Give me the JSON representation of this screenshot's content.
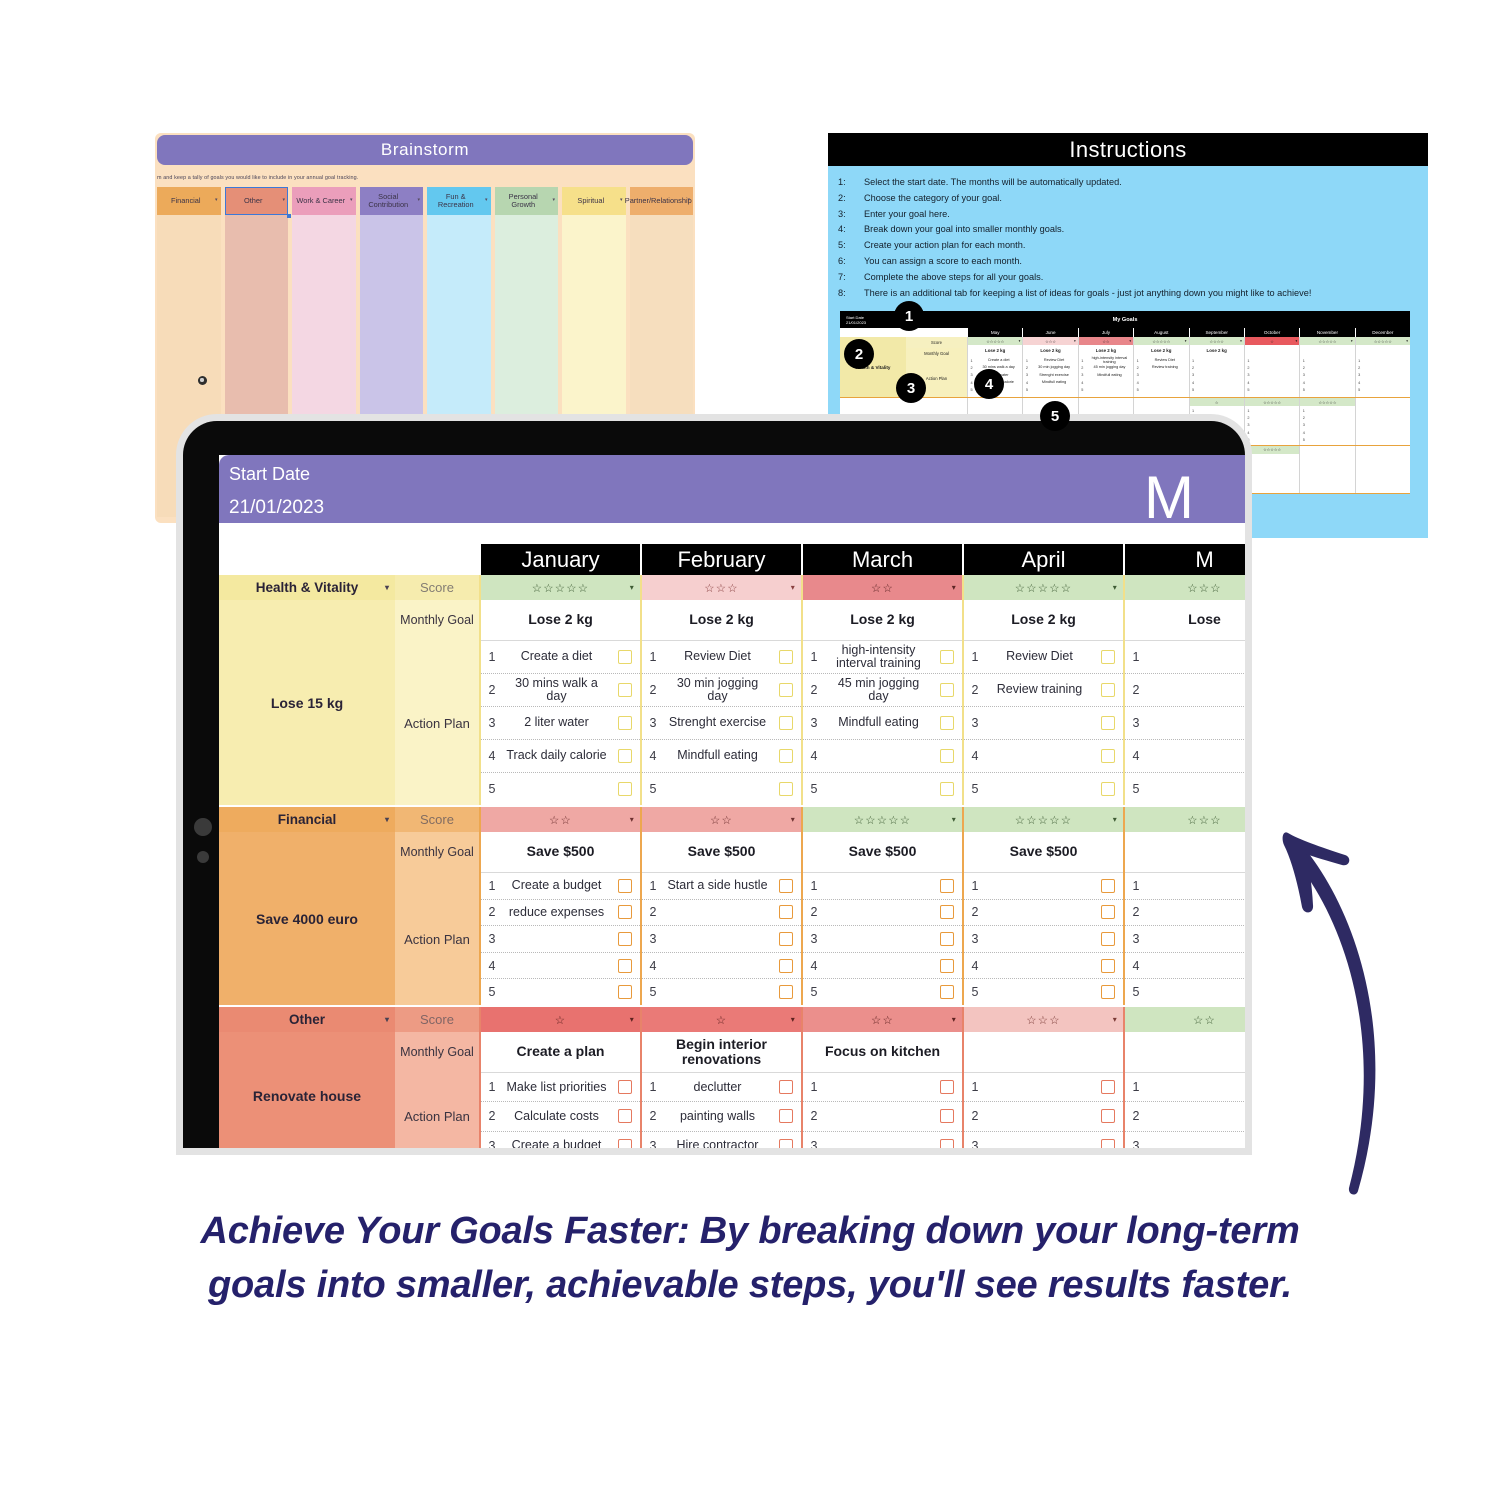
{
  "brainstorm": {
    "title": "Brainstorm",
    "subtitle": "m and keep a tally of goals you would like to include in your annual goal tracking.",
    "columns": [
      {
        "label": "Financial",
        "head_color": "#ecaa5a",
        "body_color": "#f7dcb9",
        "selected": false
      },
      {
        "label": "Other",
        "head_color": "#e58f77",
        "body_color": "#e8bdae",
        "selected": true
      },
      {
        "label": "Work & Career",
        "head_color": "#eb9ebb",
        "body_color": "#f4d7e3",
        "selected": false
      },
      {
        "label": "Social Contribution",
        "head_color": "#8d7fc4",
        "body_color": "#cac4e8",
        "selected": false
      },
      {
        "label": "Fun & Recreation",
        "head_color": "#63c8ef",
        "body_color": "#c5ebfa",
        "selected": false
      },
      {
        "label": "Personal Growth",
        "head_color": "#b7d6b0",
        "body_color": "#dceede",
        "selected": false
      },
      {
        "label": "Spiritual",
        "head_color": "#f6e08a",
        "body_color": "#fbf4cb",
        "selected": false
      },
      {
        "label": "Partner/Relationship",
        "head_color": "#eeae6c",
        "body_color": "#f6debe",
        "selected": false
      }
    ],
    "caret": "▾"
  },
  "instructions": {
    "title": "Instructions",
    "background": "#8ed8f8",
    "items": [
      {
        "num": "1:",
        "text": "Select the start date. The months will be automatically updated."
      },
      {
        "num": "2:",
        "text": "Choose the category of your goal."
      },
      {
        "num": "3:",
        "text": "Enter your goal here."
      },
      {
        "num": "4:",
        "text": "Break down your goal into smaller monthly goals."
      },
      {
        "num": "5:",
        "text": "Create your action plan for each month."
      },
      {
        "num": "6:",
        "text": "You can assign a score to each month."
      },
      {
        "num": "7:",
        "text": "Complete the above steps for all your goals."
      },
      {
        "num": "8:",
        "text": "There is an additional tab for keeping a list of ideas for goals - just jot anything down you might like to achieve!"
      }
    ],
    "badges": [
      "1",
      "2",
      "3",
      "4",
      "5"
    ]
  },
  "mini_sheet": {
    "start_date_label": "Start Date",
    "start_date_value": "21/01/2023",
    "title": "My Goals",
    "months": [
      "May",
      "June",
      "July",
      "August",
      "September",
      "October",
      "November",
      "December"
    ],
    "labels": {
      "score": "Score",
      "monthly_goal": "Monthly Goal",
      "action_plan": "Action Plan"
    },
    "blocks": [
      {
        "category": "Health & Vitality",
        "goal": "Lose 15 kg",
        "cat_color": "#f2e9a8",
        "goal_color": "#f7f0bd",
        "months": [
          {
            "stars": "☆☆☆☆☆",
            "bg": "#d4e8c8",
            "goal": "Lose 2 kg",
            "tasks": [
              "Create a diet",
              "30 mins walk a day",
              "2 liter water",
              "Track daily calorie",
              ""
            ]
          },
          {
            "stars": "☆☆☆",
            "bg": "#f6d3d3",
            "goal": "Lose 2 kg",
            "tasks": [
              "Review Diet",
              "30 min jogging day",
              "Strenght exercise",
              "Mindfull eating",
              ""
            ]
          },
          {
            "stars": "☆☆",
            "bg": "#e8868a",
            "goal": "Lose 2 kg",
            "tasks": [
              "high-intensity interval training",
              "45 min jogging day",
              "Mindfull eating",
              "",
              ""
            ]
          },
          {
            "stars": "☆☆☆☆☆",
            "bg": "#d4e8c8",
            "goal": "Lose 2 kg",
            "tasks": [
              "Review Diet",
              "Review training",
              "",
              "",
              ""
            ]
          },
          {
            "stars": "☆☆☆☆",
            "bg": "#d4e8c8",
            "goal": "Lose 2 kg",
            "tasks": [
              "",
              "",
              "",
              "",
              ""
            ]
          },
          {
            "stars": "☆",
            "bg": "#e8595e",
            "goal": "",
            "tasks": [
              "",
              "",
              "",
              "",
              ""
            ]
          },
          {
            "stars": "☆☆☆☆☆",
            "bg": "#d4e8c8",
            "goal": "",
            "tasks": [
              "",
              "",
              "",
              "",
              ""
            ]
          },
          {
            "stars": "☆☆☆☆☆",
            "bg": "#d4e8c8",
            "goal": "",
            "tasks": [
              "",
              "",
              "",
              "",
              ""
            ]
          }
        ]
      }
    ],
    "extra_rows": [
      {
        "stars": [
          "",
          "",
          "",
          "",
          "☆",
          "☆☆☆☆☆",
          "☆☆☆☆☆",
          ""
        ]
      },
      {
        "stars": [
          "",
          "",
          "",
          "",
          "☆☆☆☆☆",
          "☆☆☆☆☆",
          "",
          ""
        ]
      }
    ]
  },
  "tablet": {
    "start_date_label": "Start Date",
    "start_date_value": "21/01/2023",
    "brand": "M",
    "labels": {
      "score": "Score",
      "monthly_goal": "Monthly Goal",
      "action_plan": "Action Plan"
    },
    "months": [
      "January",
      "February",
      "March",
      "April",
      "M"
    ],
    "caret": "▾",
    "blocks": [
      {
        "category": "Health & Vitality",
        "goal": "Lose 15 kg",
        "cat_header_color": "#f4e9a0",
        "cat_body_color": "#f7edb0",
        "label_color": "#faf3c7",
        "border_color": "#f2e08a",
        "checkbox_color": "#e8d86a",
        "months": [
          {
            "stars": "☆☆☆☆☆",
            "score_bg": "#cfe5c0",
            "score_color": "#3e5c34",
            "goal": "Lose 2 kg",
            "tasks": [
              "Create a diet",
              "30 mins walk a day",
              "2 liter water",
              "Track daily calorie",
              ""
            ]
          },
          {
            "stars": "☆☆☆",
            "score_bg": "#f6cfcf",
            "score_color": "#8a4040",
            "goal": "Lose 2 kg",
            "tasks": [
              "Review Diet",
              "30 min jogging day",
              "Strenght exercise",
              "Mindfull eating",
              ""
            ]
          },
          {
            "stars": "☆☆",
            "score_bg": "#e8898c",
            "score_color": "#5e2526",
            "goal": "Lose 2 kg",
            "tasks": [
              "high-intensity interval training",
              "45 min jogging day",
              "Mindfull eating",
              "",
              ""
            ]
          },
          {
            "stars": "☆☆☆☆☆",
            "score_bg": "#cfe5c0",
            "score_color": "#3e5c34",
            "goal": "Lose 2 kg",
            "tasks": [
              "Review Diet",
              "Review training",
              "",
              "",
              ""
            ]
          },
          {
            "stars": "☆☆☆",
            "score_bg": "#cfe5c0",
            "score_color": "#3e5c34",
            "goal": "Lose",
            "tasks": [
              "",
              "",
              "",
              "",
              ""
            ]
          }
        ]
      },
      {
        "category": "Financial",
        "goal": "Save 4000 euro",
        "cat_header_color": "#eeab5e",
        "cat_body_color": "#f0b06a",
        "label_color": "#f7cb99",
        "border_color": "#eda74f",
        "checkbox_color": "#e89a3c",
        "months": [
          {
            "stars": "☆☆",
            "score_bg": "#efa8a4",
            "score_color": "#6e3030",
            "goal": "Save $500",
            "tasks": [
              "Create a budget",
              "reduce expenses",
              "",
              "",
              ""
            ]
          },
          {
            "stars": "☆☆",
            "score_bg": "#efa8a4",
            "score_color": "#6e3030",
            "goal": "Save $500",
            "tasks": [
              "Start a side hustle",
              "",
              "",
              "",
              ""
            ]
          },
          {
            "stars": "☆☆☆☆☆",
            "score_bg": "#cfe5c0",
            "score_color": "#3e5c34",
            "goal": "Save $500",
            "tasks": [
              "",
              "",
              "",
              "",
              ""
            ]
          },
          {
            "stars": "☆☆☆☆☆",
            "score_bg": "#cfe5c0",
            "score_color": "#3e5c34",
            "goal": "Save $500",
            "tasks": [
              "",
              "",
              "",
              "",
              ""
            ]
          },
          {
            "stars": "☆☆☆",
            "score_bg": "#cfe5c0",
            "score_color": "#3e5c34",
            "goal": "",
            "tasks": [
              "",
              "",
              "",
              "",
              ""
            ]
          }
        ]
      },
      {
        "category": "Other",
        "goal": "Renovate house",
        "cat_header_color": "#ea8a72",
        "cat_body_color": "#ec9077",
        "label_color": "#f4b7a3",
        "border_color": "#e8836a",
        "checkbox_color": "#e5795f",
        "months": [
          {
            "stars": "☆",
            "score_bg": "#e8726f",
            "score_color": "#5e2220",
            "goal": "Create a plan",
            "tasks": [
              "Make list priorities",
              "Calculate costs",
              "Create a budget"
            ]
          },
          {
            "stars": "☆",
            "score_bg": "#ea7a77",
            "score_color": "#5e2220",
            "goal": "Begin interior renovations",
            "tasks": [
              "declutter",
              "painting walls",
              "Hire contractor"
            ]
          },
          {
            "stars": "☆☆",
            "score_bg": "#eb8f8c",
            "score_color": "#5e2220",
            "goal": "Focus on kitchen",
            "tasks": [
              "",
              "",
              ""
            ]
          },
          {
            "stars": "☆☆☆",
            "score_bg": "#f3c4c0",
            "score_color": "#7a3a36",
            "goal": "",
            "tasks": [
              "",
              "",
              ""
            ]
          },
          {
            "stars": "☆☆",
            "score_bg": "#cfe5c0",
            "score_color": "#3e5c34",
            "goal": "",
            "tasks": [
              "",
              "",
              ""
            ]
          }
        ]
      }
    ]
  },
  "caption": {
    "line1": "Achieve Your Goals Faster: By breaking down your long-term",
    "line2": "goals into smaller, achievable steps, you'll see results faster.",
    "color": "#25216b"
  },
  "arrow": {
    "color": "#2e2a63"
  }
}
